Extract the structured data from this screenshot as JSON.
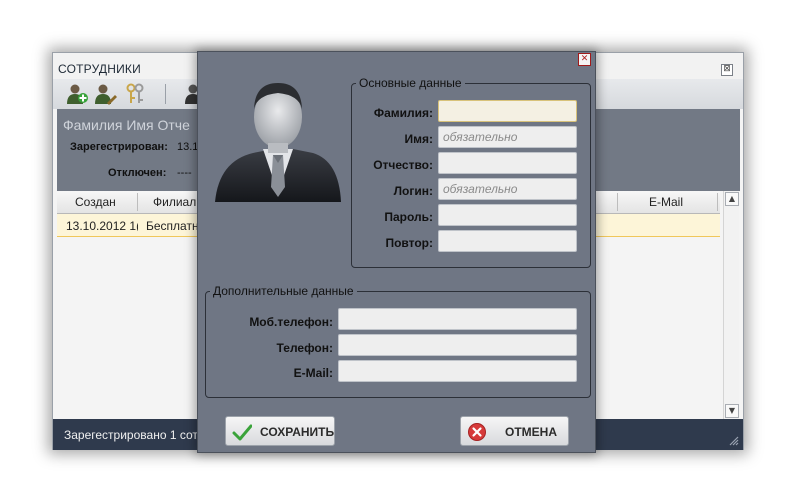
{
  "employees_window": {
    "title": "СОТРУДНИКИ",
    "close_glyph": "⊠",
    "toolbar": {
      "icons": [
        "add-user-icon",
        "edit-user-icon",
        "keys-icon",
        "user-icon"
      ]
    },
    "info": {
      "fio": "Фамилия Имя Отче",
      "registered_label": "Зарегестрирован:",
      "registered_value": "13.1",
      "disabled_label": "Отключен:",
      "disabled_value": "----"
    },
    "grid": {
      "columns": [
        "Создан",
        "Филиал",
        "E-Mail"
      ],
      "rows": [
        {
          "created": "13.10.2012 1(",
          "branch": "Бесплатн"
        }
      ]
    },
    "scroll_up": "▲",
    "scroll_down": "▼",
    "status": "Зарегестрировано 1 сот"
  },
  "dialog": {
    "close_glyph": "✕",
    "main_group": {
      "legend": "Основные данные",
      "fields": [
        {
          "label": "Фамилия:",
          "value": "",
          "placeholder": ""
        },
        {
          "label": "Имя:",
          "value": "",
          "placeholder": "обязательно"
        },
        {
          "label": "Отчество:",
          "value": "",
          "placeholder": ""
        },
        {
          "label": "Логин:",
          "value": "",
          "placeholder": "обязательно"
        },
        {
          "label": "Пароль:",
          "value": "",
          "placeholder": ""
        },
        {
          "label": "Повтор:",
          "value": "",
          "placeholder": ""
        }
      ]
    },
    "extra_group": {
      "legend": "Дополнительные данные",
      "fields": [
        {
          "label": "Моб.телефон:",
          "value": ""
        },
        {
          "label": "Телефон:",
          "value": ""
        },
        {
          "label": "E-Mail:",
          "value": ""
        }
      ]
    },
    "save_label": "СОХРАНИТЬ",
    "cancel_label": "ОТМЕНА",
    "colors": {
      "dialog_bg": "#6f7684",
      "focus_field": "#f4f0e3",
      "status_bar": "#2f3a4d",
      "selected_row": "#fdf5d8"
    }
  }
}
